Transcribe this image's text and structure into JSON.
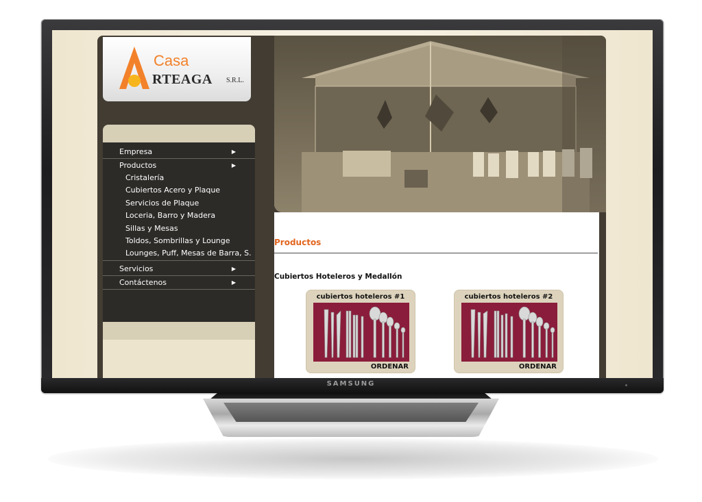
{
  "logo": {
    "casa": "Casa",
    "name": "RTEAGA",
    "srl": "S.R.L."
  },
  "menu": {
    "items": [
      {
        "label": "Empresa"
      },
      {
        "label": "Productos"
      },
      {
        "label": "Servicios"
      },
      {
        "label": "Contáctenos"
      }
    ],
    "products_sub": [
      "Cristalería",
      "Cubiertos Acero y Plaque",
      "Servicios de Plaque",
      "Loceria, Barro y Madera",
      "Sillas y Mesas",
      "Toldos, Sombrillas y Lounge",
      "Lounges, Puff, Mesas de Barra, S."
    ]
  },
  "content": {
    "title": "Productos",
    "subtitle": "Cubiertos Hoteleros y Medallón",
    "cards": [
      {
        "title": "cubiertos hoteleros #1",
        "action": "ORDENAR"
      },
      {
        "title": "cubiertos hoteleros #2",
        "action": "ORDENAR"
      }
    ]
  },
  "monitor": {
    "brand": "SAMSUNG"
  },
  "colors": {
    "accent_orange": "#e2661f",
    "page_brown": "#423c33",
    "sidebar_dark": "#2d2b28",
    "card_bg": "#ddd3bd",
    "cutlery_bg": "#8a1d3b"
  }
}
